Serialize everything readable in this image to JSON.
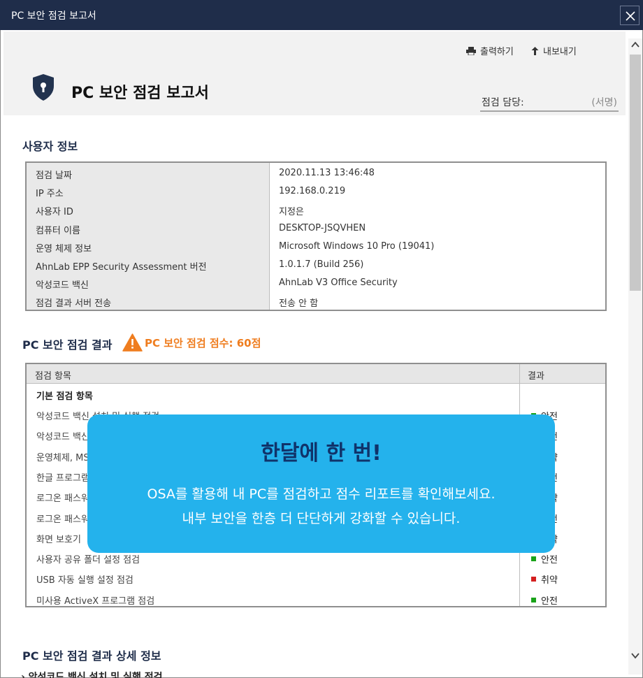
{
  "window": {
    "title": "PC 보안 점검 보고서"
  },
  "toolbar": {
    "print_label": "출력하기",
    "export_label": "내보내기"
  },
  "report": {
    "title": "PC 보안 점검 보고서",
    "inspector_label": "점검 담당:",
    "signature_placeholder": "(서명)"
  },
  "user_info": {
    "section_title": "사용자 정보",
    "rows": [
      {
        "label": "점검 날짜",
        "value": "2020.11.13 13:46:48"
      },
      {
        "label": "IP 주소",
        "value": "192.168.0.219"
      },
      {
        "label": "사용자 ID",
        "value": "지정은"
      },
      {
        "label": "컴퓨터 이름",
        "value": "DESKTOP-JSQVHEN"
      },
      {
        "label": "운영 체제 정보",
        "value": "Microsoft Windows 10 Pro (19041)"
      },
      {
        "label": "AhnLab EPP Security Assessment 버전",
        "value": "1.0.1.7 (Build 256)"
      },
      {
        "label": "악성코드 백신",
        "value": "AhnLab V3 Office Security"
      },
      {
        "label": "점검 결과 서버 전송",
        "value": "전송 안 함"
      }
    ]
  },
  "results": {
    "section_title": "PC 보안 점검 결과",
    "score_text": "PC 보안 점검 점수: 60점",
    "header": {
      "item": "점검 항목",
      "result": "결과"
    },
    "group_label": "기본 점검 항목",
    "rows": [
      {
        "name": "악성코드 백신 설치 및 실행 점검",
        "status": "안전",
        "color": "#1aa31a"
      },
      {
        "name": "악성코드 백신",
        "status": "안전",
        "color": "#1aa31a"
      },
      {
        "name": "운영체제, MS",
        "status": "취약",
        "color": "#d42020"
      },
      {
        "name": "한글 프로그램",
        "status": "안전",
        "color": "#1aa31a"
      },
      {
        "name": "로그온 패스워드",
        "status": "취약",
        "color": "#d42020"
      },
      {
        "name": "로그온 패스워드",
        "status": "안전",
        "color": "#1aa31a"
      },
      {
        "name": "화면 보호기",
        "status": "취약",
        "color": "#d42020"
      },
      {
        "name": "사용자 공유 폴더 설정 점검",
        "status": "안전",
        "color": "#1aa31a"
      },
      {
        "name": "USB 자동 실행 설정 점검",
        "status": "취약",
        "color": "#d42020"
      },
      {
        "name": "미사용 ActiveX 프로그램 점검",
        "status": "안전",
        "color": "#1aa31a"
      }
    ]
  },
  "details": {
    "section_title": "PC 보안 점검 결과 상세 정보",
    "first_item": "› 악성코드 백신 설치 및 실행 점검"
  },
  "promo": {
    "heading": "한달에 한 번!",
    "line1": "OSA를 활용해 내 PC를 점검하고 점수 리포트를 확인해보세요.",
    "line2": "내부 보안을 한층 더 단단하게 강화할 수 있습니다."
  },
  "colors": {
    "titlebar": "#1f2d4a",
    "accent_orange": "#ef7d1f",
    "promo_bg": "#24b2ec",
    "promo_heading": "#10336a",
    "safe": "#1aa31a",
    "vulnerable": "#d42020"
  },
  "icons": [
    "close-icon",
    "printer-icon",
    "arrow-up-icon",
    "shield-lock-icon",
    "warning-icon",
    "scroll-up-icon",
    "scroll-down-icon"
  ]
}
